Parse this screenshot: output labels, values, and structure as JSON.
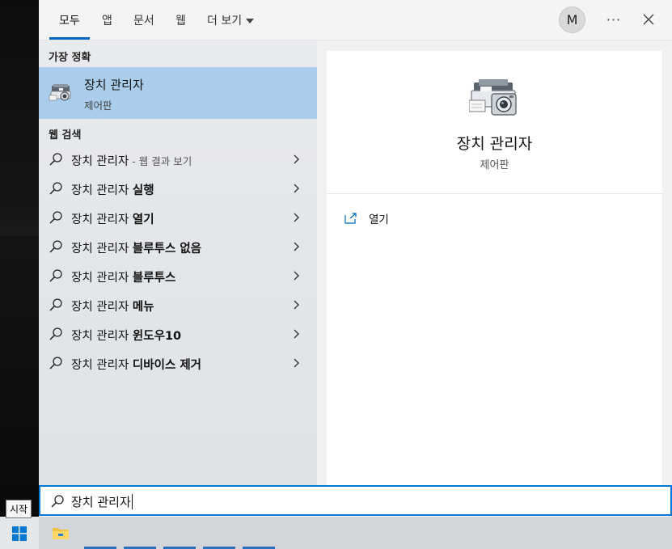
{
  "tabs": [
    {
      "label": "모두"
    },
    {
      "label": "앱"
    },
    {
      "label": "문서"
    },
    {
      "label": "웹"
    },
    {
      "label": "더 보기"
    }
  ],
  "account": {
    "initial": "M"
  },
  "more_label": "···",
  "sections": {
    "best_match": "가장 정확",
    "web_search": "웹 검색"
  },
  "best_match": {
    "title": "장치 관리자",
    "subtitle": "제어판"
  },
  "web_results": [
    {
      "prefix": "장치 관리자",
      "bold": "",
      "suffix": " - 웹 결과 보기"
    },
    {
      "prefix": "장치 관리자 ",
      "bold": "실행",
      "suffix": ""
    },
    {
      "prefix": "장치 관리자 ",
      "bold": "열기",
      "suffix": ""
    },
    {
      "prefix": "장치 관리자 ",
      "bold": "블루투스 없음",
      "suffix": ""
    },
    {
      "prefix": "장치 관리자 ",
      "bold": "블루투스",
      "suffix": ""
    },
    {
      "prefix": "장치 관리자 ",
      "bold": "메뉴",
      "suffix": ""
    },
    {
      "prefix": "장치 관리자 ",
      "bold": "윈도우10",
      "suffix": ""
    },
    {
      "prefix": "장치 관리자 ",
      "bold": "디바이스 제거",
      "suffix": ""
    }
  ],
  "detail": {
    "title": "장치 관리자",
    "subtitle": "제어판",
    "actions": [
      {
        "label": "열기",
        "icon": "open-icon"
      }
    ]
  },
  "search": {
    "query": "장치 관리자"
  },
  "taskbar": {
    "start_tooltip": "시작"
  },
  "colors": {
    "accent": "#0078d4",
    "selection": "#a9cdea"
  }
}
